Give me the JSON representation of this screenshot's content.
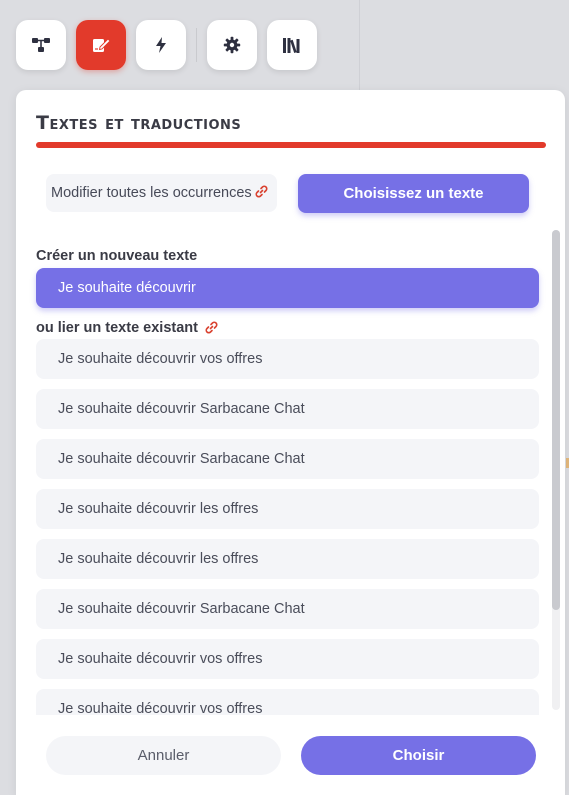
{
  "toolbar": {
    "buttons": [
      {
        "icon": "hierarchy-icon",
        "active": false
      },
      {
        "icon": "edit-text-icon",
        "active": true
      },
      {
        "icon": "lightning-icon",
        "active": false
      },
      {
        "icon": "gear-icon",
        "active": false
      },
      {
        "icon": "library-icon",
        "active": false
      }
    ],
    "active_color": "#e23a2b"
  },
  "panel": {
    "title": "Textes et traductions",
    "edit_all_label": "Modifier toutes les occurrences",
    "choose_text_label": "Choisissez un texte",
    "create_label": "Créer un nouveau texte",
    "new_text_value": "Je souhaite découvrir",
    "link_label": "ou lier un texte existant",
    "existing_texts": [
      "Je souhaite découvrir vos offres",
      "Je souhaite découvrir Sarbacane Chat",
      "Je souhaite découvrir Sarbacane Chat",
      "Je souhaite découvrir les offres",
      "Je souhaite découvrir les offres",
      "Je souhaite découvrir Sarbacane Chat",
      "Je souhaite découvrir vos offres",
      "Je souhaite découvrir vos offres"
    ],
    "cancel_label": "Annuler",
    "choose_label": "Choisir"
  },
  "colors": {
    "accent": "#7670e6",
    "brand_red": "#e23a2b",
    "link_icon": "#d9412f"
  }
}
